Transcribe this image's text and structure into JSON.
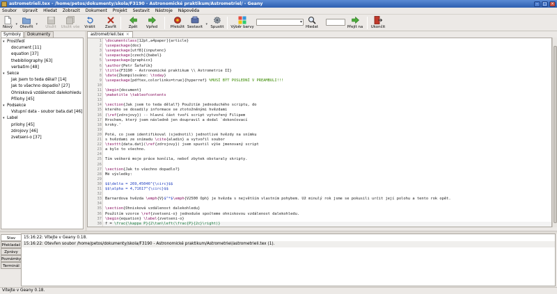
{
  "window": {
    "title": "astrometrieli.tex - /home/petos/dokumenty/skola/F3190 - Astronomické praktikum/Astrometriel/ - Geany"
  },
  "menu": [
    "Soubor",
    "Upravit",
    "Hledat",
    "Zobrazit",
    "Dokument",
    "Projekt",
    "Sestavit",
    "Nástroje",
    "Nápověda"
  ],
  "toolbar": {
    "new": "Nový",
    "open": "Otevřít",
    "save": "Uložit",
    "save_all": "Uložit vše",
    "revert": "Vrátit",
    "close": "Zavřít",
    "back": "Zpět",
    "forward": "Vpřed",
    "compile": "Přeložit",
    "build": "Sestavit",
    "run": "Spustit",
    "color": "Výběr barvy",
    "search": "Hledat",
    "goto": "Přejít na",
    "quit": "Ukončit"
  },
  "sidebar": {
    "tabs": [
      "Symboly",
      "Dokumenty"
    ],
    "tree": [
      {
        "label": "Prostředí",
        "level": 0,
        "expanded": true
      },
      {
        "label": "document [11]",
        "level": 1
      },
      {
        "label": "equation [37]",
        "level": 1
      },
      {
        "label": "thebibliography [63]",
        "level": 1
      },
      {
        "label": "verbatim [48]",
        "level": 1
      },
      {
        "label": "Sekce",
        "level": 0,
        "expanded": true
      },
      {
        "label": "Jak jsem to teda dělal? [14]",
        "level": 1
      },
      {
        "label": "Jak to všechno dopadlo? [27]",
        "level": 1
      },
      {
        "label": "Ohnisková vzdálenost dalekohledu [35]",
        "level": 1
      },
      {
        "label": "Přílohy [45]",
        "level": 1
      },
      {
        "label": "Podsekce",
        "level": 0,
        "expanded": true
      },
      {
        "label": "Vstupní data - soubor bata.dat [46]",
        "level": 1
      },
      {
        "label": "Label",
        "level": 0,
        "expanded": true
      },
      {
        "label": "prilohy [45]",
        "level": 1
      },
      {
        "label": "zdrojovy [46]",
        "level": 1
      },
      {
        "label": "zvetseni-o [37]",
        "level": 1
      }
    ]
  },
  "editor": {
    "tab_label": "astrometrieli.tex",
    "lines": [
      {
        "n": "1",
        "segments": [
          [
            "kw",
            "\\documentclass"
          ],
          [
            "plain",
            "[12pt,a4paper]{article}"
          ]
        ]
      },
      {
        "n": "2",
        "segments": [
          [
            "kw",
            "\\usepackage"
          ],
          [
            "plain",
            "{doc}"
          ]
        ]
      },
      {
        "n": "3",
        "segments": [
          [
            "kw",
            "\\usepackage"
          ],
          [
            "plain",
            "[utf8]{inputenc}"
          ]
        ]
      },
      {
        "n": "4",
        "segments": [
          [
            "kw",
            "\\usepackage"
          ],
          [
            "plain",
            "[czech]{babel}"
          ]
        ]
      },
      {
        "n": "5",
        "segments": [
          [
            "kw",
            "\\usepackage"
          ],
          [
            "plain",
            "{graphicx}"
          ]
        ]
      },
      {
        "n": "6",
        "segments": [
          [
            "kw",
            "\\author"
          ],
          [
            "plain",
            "{Petr Šafařík}"
          ]
        ]
      },
      {
        "n": "7",
        "segments": [
          [
            "kw",
            "\\title"
          ],
          [
            "plain",
            "{F3190 - Astronomické praktikum \\\\ Astrometrie II}"
          ]
        ]
      },
      {
        "n": "8",
        "segments": [
          [
            "kw",
            "\\date"
          ],
          [
            "plain",
            "{Zkompilováno: "
          ],
          [
            "kw",
            "\\today"
          ],
          [
            "plain",
            "}"
          ]
        ]
      },
      {
        "n": "9",
        "segments": [
          [
            "kw",
            "\\usepackage"
          ],
          [
            "plain",
            "[pdftex,colorlinks=true]{hyperref} "
          ],
          [
            "cmt",
            "%MUSÍ BÝT POSLEDNÍ V PREAMBULI!!!"
          ]
        ]
      },
      {
        "n": "10",
        "segments": []
      },
      {
        "n": "11",
        "segments": [
          [
            "kw",
            "\\begin"
          ],
          [
            "plain",
            "{document}"
          ]
        ]
      },
      {
        "n": "12",
        "segments": [
          [
            "kw",
            "\\maketitle"
          ],
          [
            "plain",
            " "
          ],
          [
            "kw",
            "\\tableofcontents"
          ]
        ]
      },
      {
        "n": "13",
        "segments": []
      },
      {
        "n": "14",
        "segments": [
          [
            "kw",
            "\\section"
          ],
          [
            "plain",
            "{Jak jsem to teda dělal?} Použitím jednoduchého scriptu, do"
          ]
        ]
      },
      {
        "n": "15",
        "segments": [
          [
            "plain",
            "kterého se dosadily informace se ztotožněnými hvězdami"
          ]
        ]
      },
      {
        "n": "16",
        "segments": [
          [
            "plain",
            "("
          ],
          [
            "kw",
            "\\ref"
          ],
          [
            "plain",
            "{zdrojovy}) -- hlavní část tvoří script vytvořený Filipem"
          ]
        ]
      },
      {
        "n": "17",
        "segments": [
          [
            "plain",
            "Hrochem, který jsem následně jen doupravil a dodal `dokončovací"
          ]
        ]
      },
      {
        "n": "18",
        "segments": [
          [
            "plain",
            "kroky.'"
          ]
        ]
      },
      {
        "n": "19",
        "segments": []
      },
      {
        "n": "20",
        "segments": [
          [
            "plain",
            "Poté, co jsem identifikoval (sjednotil) jednotlivé hvězdy na snímku"
          ]
        ]
      },
      {
        "n": "21",
        "segments": [
          [
            "plain",
            "s hvězdami ze snímadu "
          ],
          [
            "kw",
            "\\cite"
          ],
          [
            "plain",
            "{aladin} a vytvořil soubor"
          ]
        ]
      },
      {
        "n": "22",
        "segments": [
          [
            "kw",
            "\\texttt"
          ],
          [
            "plain",
            "{data.dat}("
          ],
          [
            "kw",
            "\\ref"
          ],
          [
            "plain",
            "{zdrojovy}) jsem spustil výše jmenovaný script"
          ]
        ]
      },
      {
        "n": "23",
        "segments": [
          [
            "plain",
            "a bylo to všechno."
          ]
        ]
      },
      {
        "n": "24",
        "segments": []
      },
      {
        "n": "25",
        "segments": [
          [
            "plain",
            "Tím veškerá moje práce končila, neboť zbytek obstaraly skripty."
          ]
        ]
      },
      {
        "n": "26",
        "segments": []
      },
      {
        "n": "27",
        "segments": [
          [
            "kw",
            "\\section"
          ],
          [
            "plain",
            "{Jak to všechno dopadlo?}"
          ]
        ]
      },
      {
        "n": "28",
        "segments": [
          [
            "plain",
            "Mé výsledky:"
          ]
        ]
      },
      {
        "n": "29",
        "segments": []
      },
      {
        "n": "30",
        "segments": [
          [
            "blu",
            "$$\\delta = 269,45046^{\\circ}$$"
          ]
        ]
      },
      {
        "n": "31",
        "segments": [
          [
            "blu",
            "$$\\alpha = 4,71617^{\\circ}$$"
          ]
        ]
      },
      {
        "n": "32",
        "segments": []
      },
      {
        "n": "33",
        "segments": [
          [
            "plain",
            "Barnardova hvězda "
          ],
          [
            "kw",
            "\\emph"
          ],
          [
            "plain",
            "{V}"
          ],
          [
            "blu",
            "$^*$"
          ],
          [
            "kw",
            "\\emph"
          ],
          [
            "plain",
            "{V2500 Oph} je hvězda s největším vlastním pohybem. Už minulý rok jsme se pokusili určit její polohu a tento rok opět."
          ]
        ]
      },
      {
        "n": "34",
        "segments": []
      },
      {
        "n": "35",
        "segments": [
          [
            "kw",
            "\\section"
          ],
          [
            "plain",
            "{Ohnisková vzdálenost dalekohledu}"
          ]
        ]
      },
      {
        "n": "36",
        "segments": [
          [
            "plain",
            "Použitím vzorce "
          ],
          [
            "kw",
            "\\ref"
          ],
          [
            "plain",
            "{zvetseni-o} jednoduše spočteme ohniskovou vzdálenost dalekohledu."
          ]
        ]
      },
      {
        "n": "37",
        "segments": [
          [
            "kw",
            "\\begin"
          ],
          [
            "plain",
            "{equation} "
          ],
          [
            "kw",
            "\\label"
          ],
          [
            "plain",
            "{zvetseni-o}"
          ]
        ]
      },
      {
        "n": "38",
        "segments": [
          [
            "plain",
            "f = "
          ],
          [
            "grn",
            "\\frac{\\kappa P}{2\\tan\\left(\\frac{P}{2c}\\right)}"
          ]
        ]
      }
    ]
  },
  "messages": {
    "tabs": [
      "Stav",
      "Překladač",
      "Zprávy",
      "Poznámky",
      "Terminál"
    ],
    "lines": [
      "15:16:22: Vítejte v Geany 0.18.",
      "15:16:22: Otevřen soubor /home/petos/dokumenty/skola/F3190 - Astronomické praktikum/Astrometriel/astrometrieli.tex (1)."
    ]
  },
  "statusbar": {
    "text": "Vítejte v Geany 0.18."
  }
}
